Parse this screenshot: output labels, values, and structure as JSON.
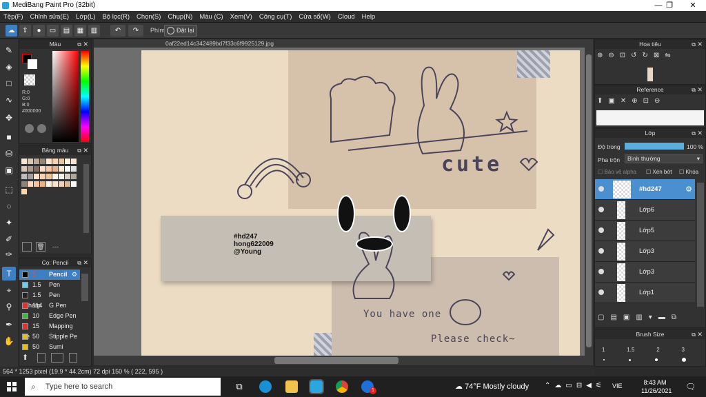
{
  "window": {
    "title": "MediBang Paint Pro (32bit)",
    "min": "—",
    "max": "❐",
    "close": "✕"
  },
  "menu": [
    "Tệp(F)",
    "Chỉnh sửa(E)",
    "Lớp(L)",
    "Bộ lọc(R)",
    "Chọn(S)",
    "Chụp(N)",
    "Màu (C)",
    "Xem(V)",
    "Công cụ(T)",
    "Cửa sổ(W)",
    "Cloud",
    "Help"
  ],
  "toolbar": {
    "key_label": "Phím",
    "reset_label": "Đặt lại"
  },
  "document": {
    "tab": "0af22ed14c342489bd7f33c6f9925129.jpg"
  },
  "color_panel": {
    "title": "Màu",
    "r": "R:0",
    "g": "G:0",
    "b": "B:0",
    "hex": "#000000"
  },
  "palette_panel": {
    "title": "Bảng màu",
    "more": "---"
  },
  "brush_panel": {
    "title": "Cọ: Pencil",
    "items": [
      {
        "size": "5",
        "name": "Pencil",
        "color": "#000000",
        "selected": true
      },
      {
        "size": "1.5",
        "name": "Pen",
        "color": "#6ad0f0"
      },
      {
        "size": "1.5",
        "name": "Pen (Sharp",
        "color": "#222222"
      },
      {
        "size": "114",
        "name": "G Pen",
        "color": "#e03030"
      },
      {
        "size": "10",
        "name": "Edge Pen",
        "color": "#30c030"
      },
      {
        "size": "15",
        "name": "Mapping Pe",
        "color": "#e03030"
      },
      {
        "size": "50",
        "name": "Stipple Pe",
        "color": "#e0c020"
      },
      {
        "size": "50",
        "name": "Sumi",
        "color": "#e0c020"
      }
    ]
  },
  "navigator_panel": {
    "title": "Hoa tiêu"
  },
  "reference_panel": {
    "title": "Reference"
  },
  "layer_panel": {
    "title": "Lớp",
    "opacity_label": "Độ trong",
    "opacity_value": "100 %",
    "opacity_fraction": 1.0,
    "blend_label": "Pha trộn",
    "blend_value": "Bình thường",
    "protect_alpha": "Bảo vệ alpha",
    "clipping": "Xén bớt",
    "lock": "Khóa",
    "layers": [
      {
        "name": "#hd247",
        "selected": true
      },
      {
        "name": "Lớp6"
      },
      {
        "name": "Lớp5"
      },
      {
        "name": "Lớp3"
      },
      {
        "name": "Lớp3"
      },
      {
        "name": "Lớp1"
      }
    ]
  },
  "brush_size_panel": {
    "title": "Brush Size",
    "sizes": [
      "1",
      "1.5",
      "2",
      "3"
    ]
  },
  "canvas_text": {
    "cute": "cute",
    "tag1": "#hd247",
    "tag2": "hong622009",
    "tag3": "@Young",
    "you_have_one": "You have one",
    "please_check": "Please check~"
  },
  "status": {
    "text": "564 * 1253 pixel   (19.9 * 44.2cm)   72 dpi   150 %   ( 222, 595 )"
  },
  "taskbar": {
    "search_placeholder": "Type here to search",
    "weather": "74°F  Mostly cloudy",
    "lang": "VIE",
    "time": "8:43 AM",
    "date": "11/26/2021",
    "notif": "1"
  }
}
